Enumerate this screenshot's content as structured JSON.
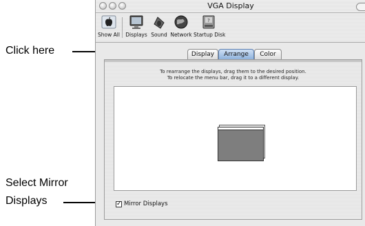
{
  "callouts": {
    "click_here": "Click here",
    "mirror_line1": "Select Mirror",
    "mirror_line2": "Displays"
  },
  "window": {
    "title": "VGA Display"
  },
  "toolbar": {
    "items": [
      {
        "label": "Show All",
        "icon": "apple-icon"
      },
      {
        "label": "Displays",
        "icon": "display-icon"
      },
      {
        "label": "Sound",
        "icon": "speaker-icon"
      },
      {
        "label": "Network",
        "icon": "globe-icon"
      },
      {
        "label": "Startup Disk",
        "icon": "disk-icon"
      }
    ]
  },
  "tabs": [
    {
      "label": "Display",
      "active": false
    },
    {
      "label": "Arrange",
      "active": true
    },
    {
      "label": "Color",
      "active": false
    }
  ],
  "panel": {
    "instruction_1": "To rearrange the displays, drag them to the desired position.",
    "instruction_2": "To relocate the menu bar, drag it to a different display.",
    "mirror_checkbox": {
      "label": "Mirror Displays",
      "checked": true
    }
  },
  "colors": {
    "active_tab": "#8fb2dc",
    "display_fill": "#7e7e7e"
  }
}
